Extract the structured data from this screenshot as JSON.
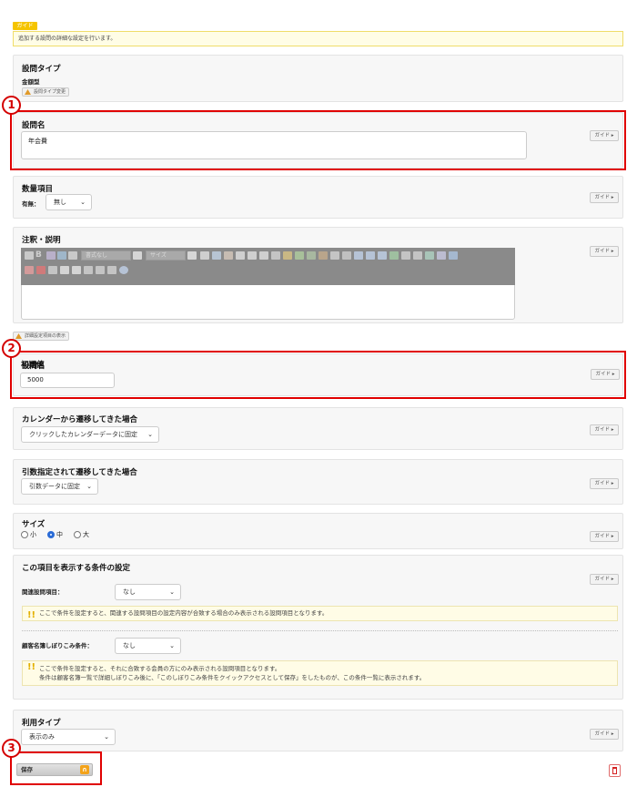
{
  "guide": {
    "tag": "ガイド",
    "text": "追加する設問の詳細な設定を行います。"
  },
  "guide_button": "ガイド ▸",
  "question_type": {
    "title": "設問タイプ",
    "value": "金額型",
    "change_button": "設問タイプ変更"
  },
  "question_name": {
    "title": "設問名",
    "value": "年会費"
  },
  "quantity": {
    "title": "数量項目",
    "label": "有無：",
    "selected": "無し"
  },
  "notes": {
    "title": "注釈・説明",
    "font_select": "書式なし",
    "size_select": "サイズ"
  },
  "advanced_toggle": "詳細設定項目の表示",
  "initial_value": {
    "title": "初期値",
    "value": "5000"
  },
  "calendar": {
    "title": "カレンダーから遷移してきた場合",
    "selected": "クリックしたカレンダーデータに固定"
  },
  "argument": {
    "title": "引数指定されて遷移してきた場合",
    "selected": "引数データに固定"
  },
  "size": {
    "title": "サイズ",
    "options": [
      "小",
      "中",
      "大"
    ],
    "selected": "中"
  },
  "condition": {
    "title": "この項目を表示する条件の設定",
    "related_label": "関連設問項目：",
    "related_selected": "なし",
    "related_note": "ここで条件を設定すると、関連する設問項目の設定内容が合致する場合のみ表示される設問項目となります。",
    "customer_label": "顧客名簿しぼりこみ条件：",
    "customer_selected": "なし",
    "customer_note_1": "ここで条件を設定すると、それに合致する会員の方にのみ表示される設問項目となります。",
    "customer_note_2": "条件は顧客名簿一覧で詳細しぼりこみ後に、「このしぼりこみ条件をクイックアクセスとして保存」をしたものが、この条件一覧に表示されます。"
  },
  "usage_type": {
    "title": "利用タイプ",
    "selected": "表示のみ"
  },
  "save_button": "保存",
  "callouts": [
    "1",
    "2",
    "3"
  ],
  "colors": {
    "callout_red": "#e00000",
    "guide_yellow": "#f5c400",
    "radio_blue": "#2a6bd6"
  }
}
